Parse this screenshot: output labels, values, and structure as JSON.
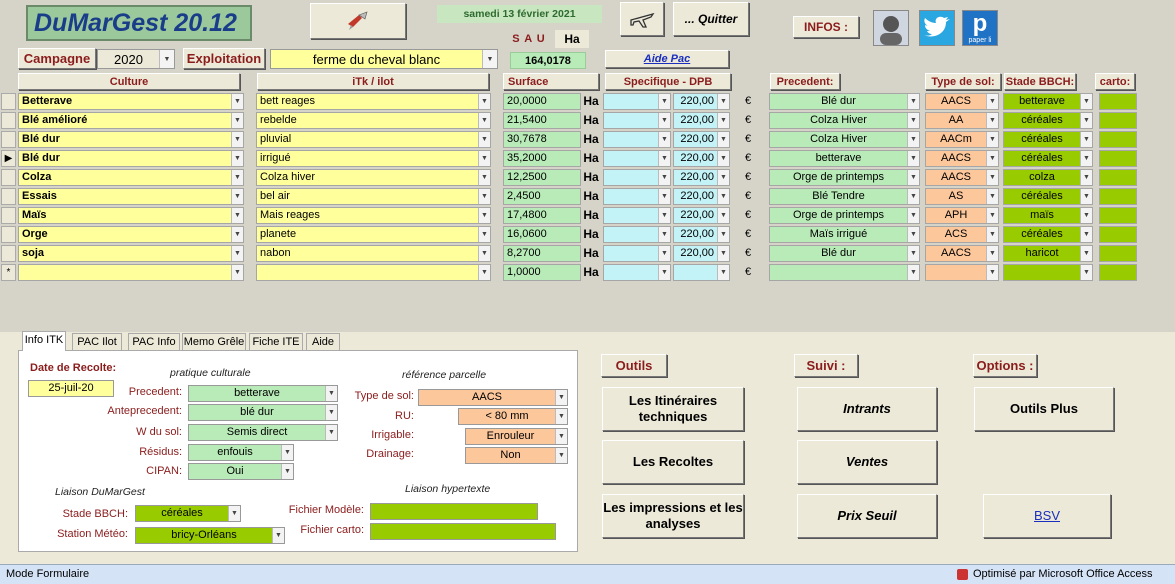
{
  "app": {
    "logo": "DuMarGest 20.12",
    "date": "samedi 13 février 2021",
    "quit": "... Quitter",
    "infos": "INFOS :",
    "sau_label": "S A U :",
    "sau_unit": "Ha",
    "sau_value": "164,0178",
    "aide_pac": "Aide Pac",
    "twitter_icon": "twitter-icon",
    "paper_icon": "paper-li-icon",
    "paper_caption": "paper li"
  },
  "filters": {
    "campagne_label": "Campagne",
    "campagne_value": "2020",
    "exploitation_label": "Exploitation",
    "exploitation_value": "ferme du cheval blanc"
  },
  "headers": {
    "culture": "Culture",
    "itk": "iTk /  ilot",
    "surface": "Surface",
    "specifique": "Specifique  -  DPB",
    "precedent": "Precedent:",
    "type_sol": "Type de sol:",
    "stade": "Stade BBCH:",
    "carto": "carto:"
  },
  "rows": [
    {
      "culture": "Betterave",
      "itk": "bett reages",
      "surface": "20,0000",
      "ha": "Ha",
      "dpb": "220,00",
      "eur": "€",
      "precedent": "Blé dur",
      "sol": "AACS",
      "stade": "betterave"
    },
    {
      "culture": "Blé amélioré",
      "itk": "rebelde",
      "surface": "21,5400",
      "ha": "Ha",
      "dpb": "220,00",
      "eur": "€",
      "precedent": "Colza Hiver",
      "sol": "AA",
      "stade": "céréales"
    },
    {
      "culture": "Blé dur",
      "itk": "pluvial",
      "surface": "30,7678",
      "ha": "Ha",
      "dpb": "220,00",
      "eur": "€",
      "precedent": "Colza Hiver",
      "sol": "AACm",
      "stade": "céréales"
    },
    {
      "culture": "Blé dur",
      "itk": "irrigué",
      "surface": "35,2000",
      "ha": "Ha",
      "dpb": "220,00",
      "eur": "€",
      "precedent": "betterave",
      "sol": "AACS",
      "stade": "céréales"
    },
    {
      "culture": "Colza",
      "itk": "Colza hiver",
      "surface": "12,2500",
      "ha": "Ha",
      "dpb": "220,00",
      "eur": "€",
      "precedent": "Orge de printemps",
      "sol": "AACS",
      "stade": "colza"
    },
    {
      "culture": "Essais",
      "itk": "bel air",
      "surface": "2,4500",
      "ha": "Ha",
      "dpb": "220,00",
      "eur": "€",
      "precedent": "Blé Tendre",
      "sol": "AS",
      "stade": "céréales"
    },
    {
      "culture": "Maïs",
      "itk": "Mais reages",
      "surface": "17,4800",
      "ha": "Ha",
      "dpb": "220,00",
      "eur": "€",
      "precedent": "Orge de printemps",
      "sol": "APH",
      "stade": "maïs"
    },
    {
      "culture": "Orge",
      "itk": "planete",
      "surface": "16,0600",
      "ha": "Ha",
      "dpb": "220,00",
      "eur": "€",
      "precedent": "Maïs irrigué",
      "sol": "ACS",
      "stade": "céréales"
    },
    {
      "culture": "soja",
      "itk": "nabon",
      "surface": "8,2700",
      "ha": "Ha",
      "dpb": "220,00",
      "eur": "€",
      "precedent": "Blé dur",
      "sol": "AACS",
      "stade": "haricot"
    },
    {
      "culture": "",
      "itk": "",
      "surface": "1,0000",
      "ha": "Ha",
      "dpb": "",
      "eur": "€",
      "precedent": "",
      "sol": "",
      "stade": ""
    }
  ],
  "new_row_marker": "*",
  "tabs": [
    "Info ITK",
    "PAC Ilot",
    "PAC Info",
    "Memo Grêle",
    "Fiche ITE",
    "Aide"
  ],
  "panel": {
    "date_label": "Date de Recolte:",
    "date_value": "25-juil-20",
    "pratique": "pratique culturale",
    "reference": "référence parcelle",
    "precedent_label": "Precedent:",
    "precedent_value": "betterave",
    "anteprecedent_label": "Anteprecedent:",
    "anteprecedent_value": "blé dur",
    "wsol_label": "W  du sol:",
    "wsol_value": "Semis direct",
    "residus_label": "Résidus:",
    "residus_value": "enfouis",
    "cipan_label": "CIPAN:",
    "cipan_value": "Oui",
    "typesol_label": "Type de sol:",
    "typesol_value": "AACS",
    "ru_label": "RU:",
    "ru_value": "< 80 mm",
    "irrigable_label": "Irrigable:",
    "irrigable_value": "Enrouleur",
    "drainage_label": "Drainage:",
    "drainage_value": "Non",
    "liaison_dmg": "Liaison DuMarGest",
    "liaison_hyper": "Liaison hypertexte",
    "stade_label": "Stade BBCH:",
    "stade_value": "céréales",
    "station_label": "Station Météo:",
    "station_value": "bricy-Orléans",
    "fichier_modele_label": "Fichier Modèle:",
    "fichier_carto_label": "Fichier carto:"
  },
  "outils": {
    "title": "Outils",
    "b1": "Les Itinéraires techniques",
    "b2": "Les Recoltes",
    "b3": "Les impressions et les analyses"
  },
  "suivi": {
    "title": "Suivi :",
    "b1": "Intrants",
    "b2": "Ventes",
    "b3": "Prix Seuil"
  },
  "options": {
    "title": "Options :",
    "b1": "Outils Plus",
    "b2": "BSV"
  },
  "status": {
    "left": "Mode Formulaire",
    "right": "Optimisé par Microsoft Office Access"
  }
}
